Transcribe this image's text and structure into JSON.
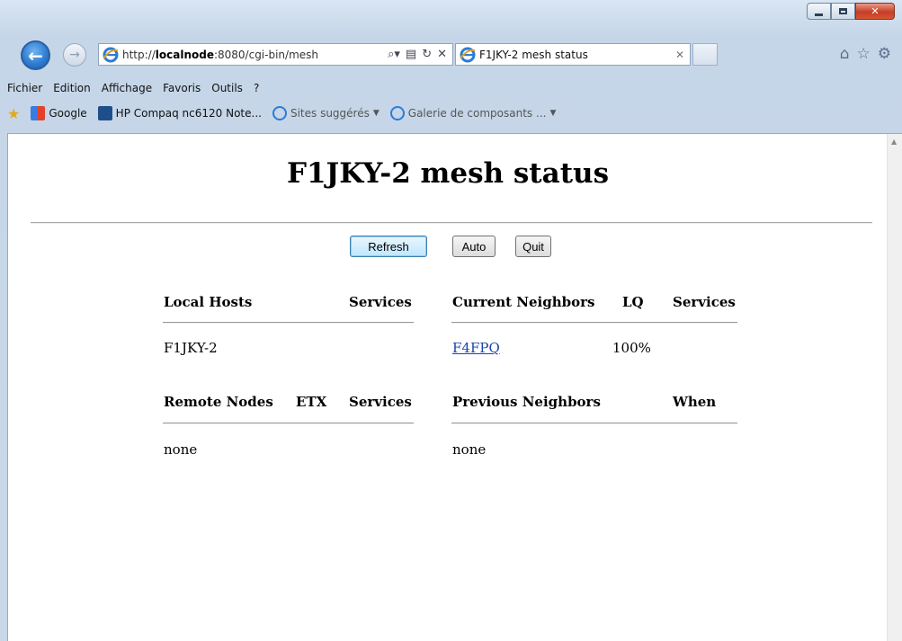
{
  "browser": {
    "address": {
      "host": "http://",
      "host_bold": "localnode",
      "rest": ":8080/cgi-bin/mesh"
    },
    "tab_title": "F1JKY-2 mesh status",
    "menu": [
      "Fichier",
      "Edition",
      "Affichage",
      "Favoris",
      "Outils",
      "?"
    ],
    "favorites": [
      {
        "label": "Google",
        "icon": "google-icon"
      },
      {
        "label": "HP Compaq nc6120 Note...",
        "icon": "hp-icon"
      },
      {
        "label": "Sites suggérés",
        "icon": "ie-icon"
      },
      {
        "label": "Galerie de composants ...",
        "icon": "ie-icon"
      }
    ]
  },
  "page": {
    "title": "F1JKY-2 mesh status",
    "buttons": {
      "refresh": "Refresh",
      "auto": "Auto",
      "quit": "Quit"
    },
    "local": {
      "headers": {
        "hosts": "Local Hosts",
        "services": "Services"
      },
      "rows": [
        {
          "host": "F1JKY-2",
          "services": ""
        }
      ]
    },
    "neighbors": {
      "headers": {
        "name": "Current Neighbors",
        "lq": "LQ",
        "services": "Services"
      },
      "rows": [
        {
          "name": "F4FPQ",
          "lq": "100%",
          "services": ""
        }
      ]
    },
    "remote": {
      "headers": {
        "nodes": "Remote Nodes",
        "etx": "ETX",
        "services": "Services"
      },
      "empty": "none"
    },
    "previous": {
      "headers": {
        "name": "Previous Neighbors",
        "when": "When"
      },
      "empty": "none"
    }
  }
}
